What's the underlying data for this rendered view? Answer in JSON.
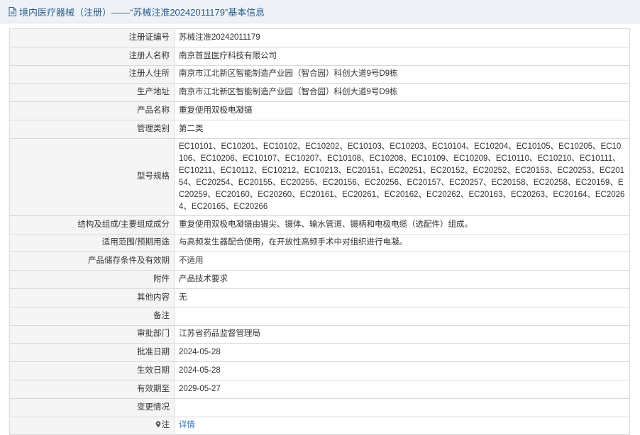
{
  "header": {
    "title": "境内医疗器械（注册）——“苏械注准20242011179”基本信息"
  },
  "rows": [
    {
      "label": "注册证编号",
      "value": "苏械注准20242011179"
    },
    {
      "label": "注册人名称",
      "value": "南京首显医疗科技有限公司"
    },
    {
      "label": "注册人住所",
      "value": "南京市江北新区智能制造产业园（智合园）科创大道9号D9栋"
    },
    {
      "label": "生产地址",
      "value": "南京市江北新区智能制造产业园（智合园）科创大道9号D9栋"
    },
    {
      "label": "产品名称",
      "value": "重复使用双极电凝镊"
    },
    {
      "label": "管理类别",
      "value": "第二类"
    },
    {
      "label": "型号规格",
      "value": "EC10101、EC10201、EC10102、EC10202、EC10103、EC10203、EC10104、EC10204、EC10105、EC10205、EC10106、EC10206、EC10107、EC10207、EC10108、EC10208、EC10109、EC10209、EC10110、EC10210、EC10111、EC10211、EC10112、EC10212、EC10213、EC20151、EC20251、EC20152、EC20252、EC20153、EC20253、EC20154、EC20254、EC20155、EC20255、EC20156、EC20256、EC20157、EC20257、EC20158、EC20258、EC20159、EC20259、EC20160、EC20260、EC20161、EC20261、EC20162、EC20262、EC20163、EC20263、EC20164、EC20264、EC20165、EC20266"
    },
    {
      "label": "结构及组成/主要组成成分",
      "value": "重复使用双极电凝镊由镊尖、镊体、输水管道、镊柄和电极电缆（选配件）组成。"
    },
    {
      "label": "适用范围/预期用途",
      "value": "与高频发生器配合使用，在开放性高频手术中对组织进行电凝。"
    },
    {
      "label": "产品储存条件及有效期",
      "value": "不适用"
    },
    {
      "label": "附件",
      "value": "产品技术要求"
    },
    {
      "label": "其他内容",
      "value": "无"
    },
    {
      "label": "备注",
      "value": ""
    },
    {
      "label": "审批部门",
      "value": "江苏省药品监督管理局"
    },
    {
      "label": "批准日期",
      "value": "2024-05-28"
    },
    {
      "label": "生效日期",
      "value": "2024-05-28"
    },
    {
      "label": "有效期至",
      "value": "2029-05-27"
    },
    {
      "label": "变更情况",
      "value": ""
    }
  ],
  "note_row": {
    "label": "注",
    "link_text": "详情",
    "icon": "map-pin-icon"
  },
  "colors": {
    "header_bg": "#eef2f7",
    "header_text": "#2c5c8a",
    "label_bg": "#f5f5f5",
    "border": "#d9d9d9",
    "link": "#2a6ebb"
  }
}
